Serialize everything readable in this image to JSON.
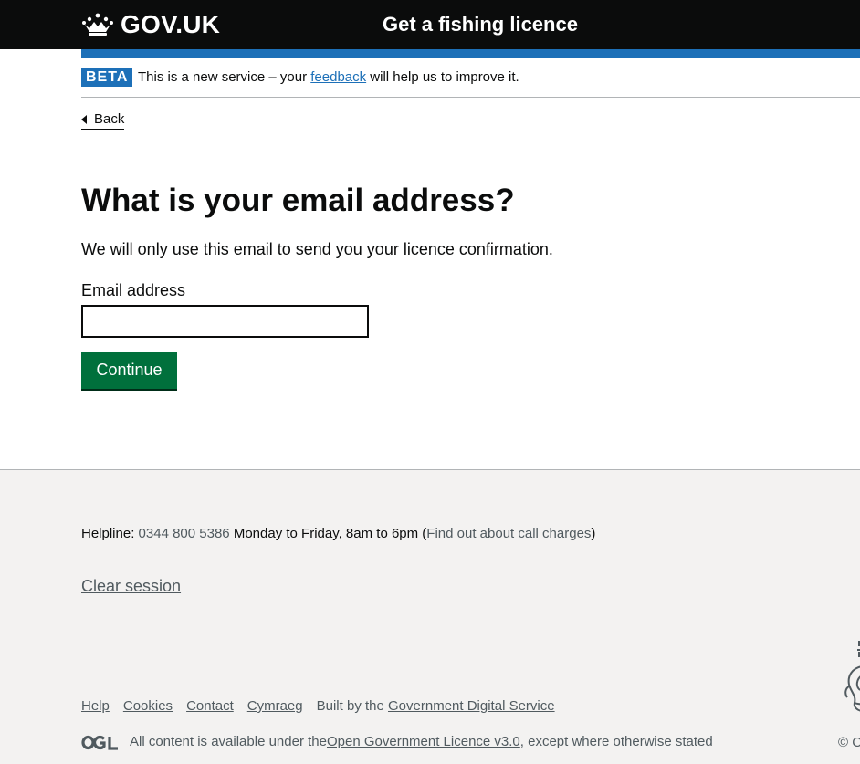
{
  "header": {
    "logo_text": "GOV.UK",
    "service_name": "Get a fishing licence"
  },
  "phase_banner": {
    "tag": "BETA",
    "text_before": "This is a new service – your ",
    "feedback_link": "feedback",
    "text_after": " will help us to improve it."
  },
  "back_link": {
    "label": "Back"
  },
  "main": {
    "title": "What is your email address?",
    "lead": "We will only use this email to send you your licence confirmation.",
    "email_label": "Email address",
    "email_value": "",
    "continue_label": "Continue"
  },
  "footer": {
    "helpline_label": "Helpline: ",
    "helpline_number": "0344 800 5386",
    "helpline_hours": " Monday to Friday, 8am to 6pm (",
    "call_charges_link": "Find out about call charges",
    "helpline_close": ")",
    "clear_session": "Clear session",
    "links": [
      "Help",
      "Cookies",
      "Contact",
      "Cymraeg"
    ],
    "built_by_text": "Built by the ",
    "built_by_link": "Government Digital Service",
    "licence_before": "All content is available under the ",
    "licence_link": "Open Government Licence v3.0",
    "licence_after": ", except where otherwise stated",
    "copyright": "© C"
  },
  "colors": {
    "header_bg": "#0b0c0c",
    "brand_blue": "#1d70b8",
    "button_green": "#00703c",
    "footer_bg": "#f3f2f1",
    "secondary_text": "#505a5f"
  },
  "icons": [
    "crown-icon",
    "back-arrow-icon",
    "ogl-logo-icon",
    "royal-crest-icon"
  ]
}
